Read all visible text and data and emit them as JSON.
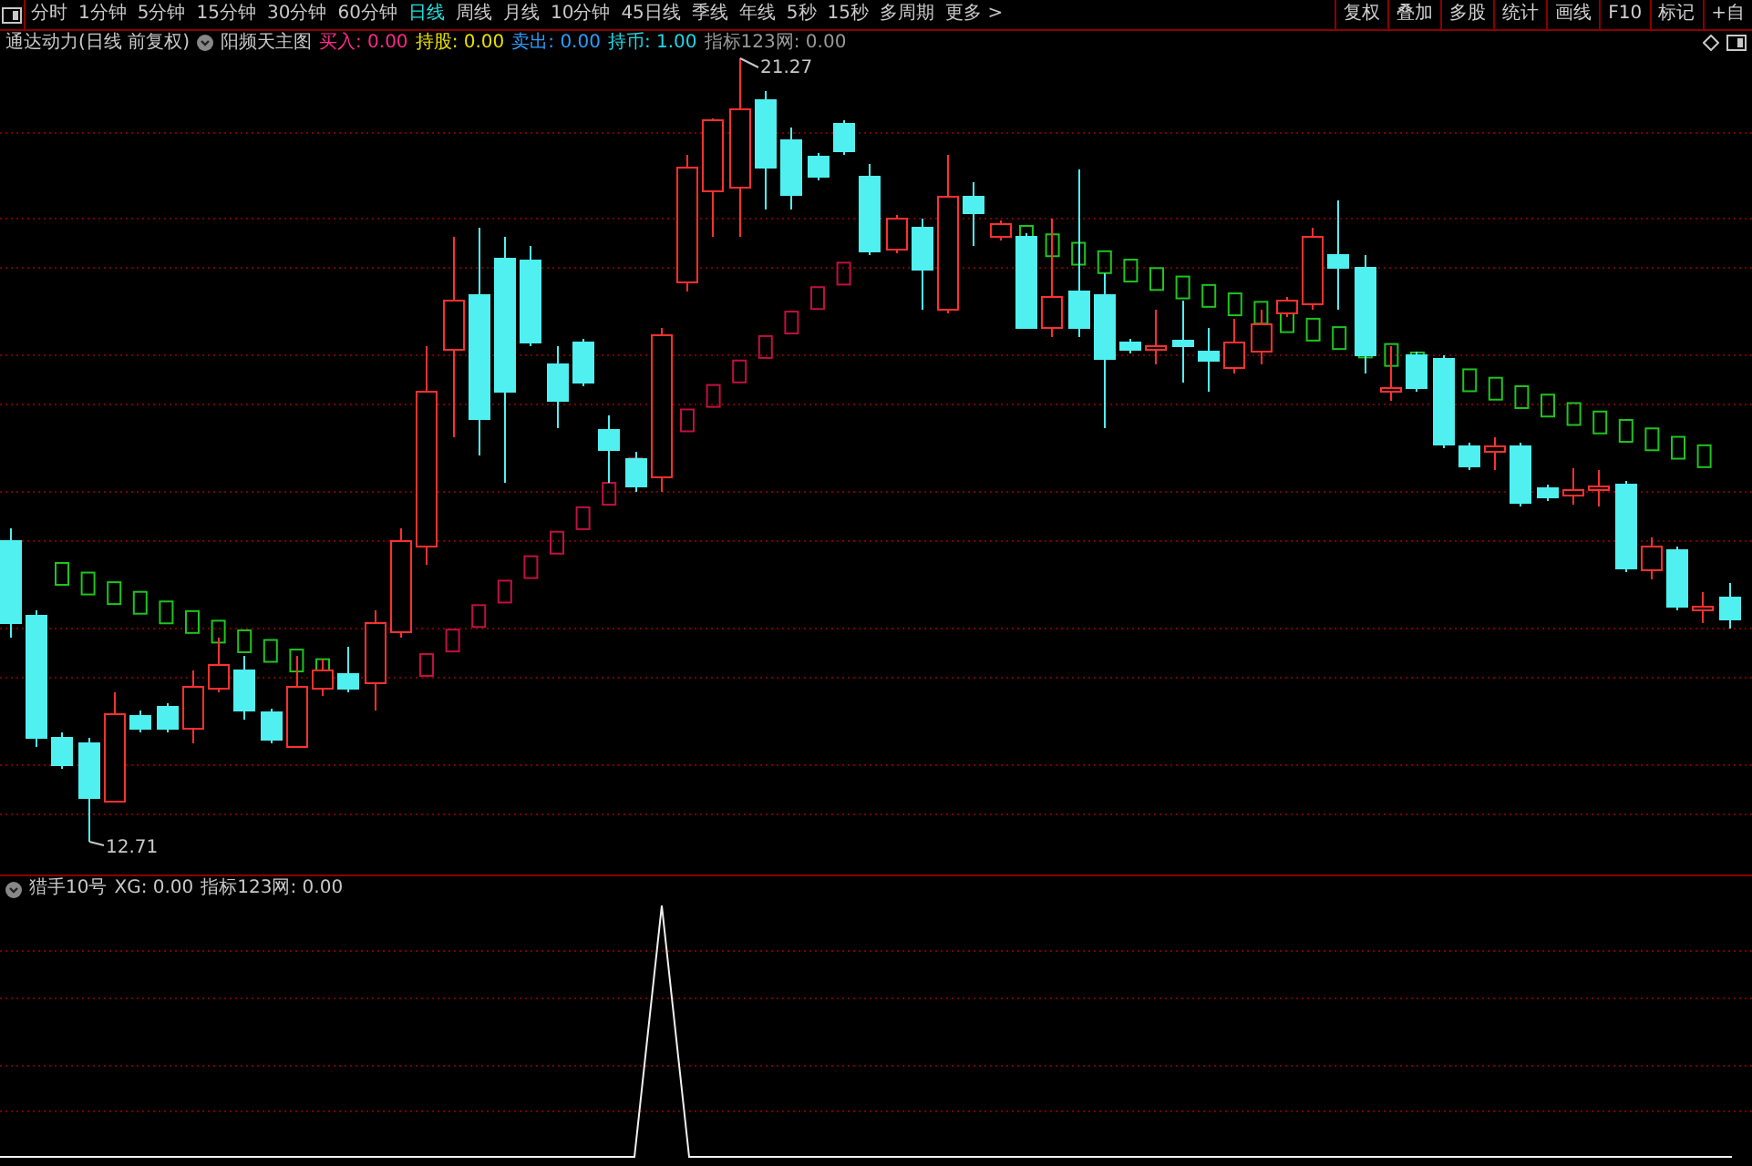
{
  "toolbar": {
    "periods": [
      {
        "label": "分时",
        "selected": false
      },
      {
        "label": "1分钟",
        "selected": false
      },
      {
        "label": "5分钟",
        "selected": false
      },
      {
        "label": "15分钟",
        "selected": false
      },
      {
        "label": "30分钟",
        "selected": false
      },
      {
        "label": "60分钟",
        "selected": false
      },
      {
        "label": "日线",
        "selected": true
      },
      {
        "label": "周线",
        "selected": false
      },
      {
        "label": "月线",
        "selected": false
      },
      {
        "label": "10分钟",
        "selected": false
      },
      {
        "label": "45日线",
        "selected": false
      },
      {
        "label": "季线",
        "selected": false
      },
      {
        "label": "年线",
        "selected": false
      },
      {
        "label": "5秒",
        "selected": false
      },
      {
        "label": "15秒",
        "selected": false
      },
      {
        "label": "多周期",
        "selected": false
      },
      {
        "label": "更多 >",
        "selected": false
      }
    ],
    "tools": [
      "复权",
      "叠加",
      "多股",
      "统计",
      "画线",
      "F10",
      "标记",
      "+自"
    ]
  },
  "main_pane": {
    "title": "通达动力(日线 前复权)",
    "indicator": "阳频天主图",
    "readouts": [
      {
        "text": "买入: 0.00",
        "color": "#ff2a8a"
      },
      {
        "text": "持股: 0.00",
        "color": "#e8e000"
      },
      {
        "text": "卖出: 0.00",
        "color": "#2aa0ff"
      },
      {
        "text": "持币: 1.00",
        "color": "#20d8e8"
      },
      {
        "text": "指标123网: 0.00",
        "color": "#9a9a9a"
      }
    ],
    "high_label": "21.27",
    "low_label": "12.71"
  },
  "sub_pane": {
    "indicator": "猎手10号",
    "readouts": [
      "XG: 0.00",
      "指标123网: 0.00"
    ]
  }
}
